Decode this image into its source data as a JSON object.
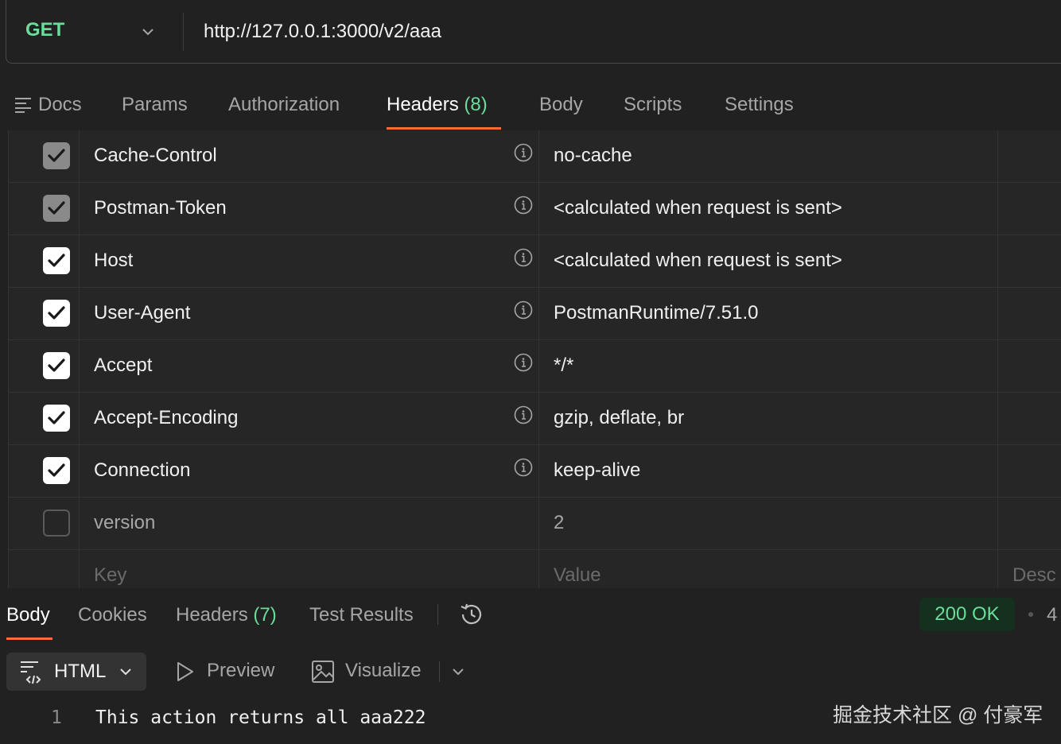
{
  "request": {
    "method": "GET",
    "url": "http://127.0.0.1:3000/v2/aaa"
  },
  "request_tabs": {
    "docs": "Docs",
    "params": "Params",
    "authorization": "Authorization",
    "headers": "Headers",
    "headers_count": "(8)",
    "body": "Body",
    "scripts": "Scripts",
    "settings": "Settings"
  },
  "headers_table": {
    "rows": [
      {
        "key": "Cache-Control",
        "value": "no-cache",
        "checked": true,
        "state": "disabled"
      },
      {
        "key": "Postman-Token",
        "value": "<calculated when request is sent>",
        "checked": true,
        "state": "disabled"
      },
      {
        "key": "Host",
        "value": "<calculated when request is sent>",
        "checked": true,
        "state": "on"
      },
      {
        "key": "User-Agent",
        "value": "PostmanRuntime/7.51.0",
        "checked": true,
        "state": "on"
      },
      {
        "key": "Accept",
        "value": "*/*",
        "checked": true,
        "state": "on"
      },
      {
        "key": "Accept-Encoding",
        "value": "gzip, deflate, br",
        "checked": true,
        "state": "on"
      },
      {
        "key": "Connection",
        "value": "keep-alive",
        "checked": true,
        "state": "on"
      },
      {
        "key": "version",
        "value": "2",
        "checked": false,
        "state": "off"
      }
    ],
    "placeholder": {
      "key": "Key",
      "value": "Value",
      "description": "Desc"
    }
  },
  "response_tabs": {
    "body": "Body",
    "cookies": "Cookies",
    "headers": "Headers",
    "headers_count": "(7)",
    "test_results": "Test Results"
  },
  "response_status": {
    "status": "200 OK",
    "extra": "4"
  },
  "response_toolbar": {
    "format": "HTML",
    "preview": "Preview",
    "visualize": "Visualize"
  },
  "response_body": {
    "line_number": "1",
    "text": "This action returns all aaa222"
  },
  "watermark": "掘金技术社区 @ 付豪军",
  "colors": {
    "accent": "#ff6c37",
    "method_green": "#6bdd9a",
    "background": "#212121"
  }
}
